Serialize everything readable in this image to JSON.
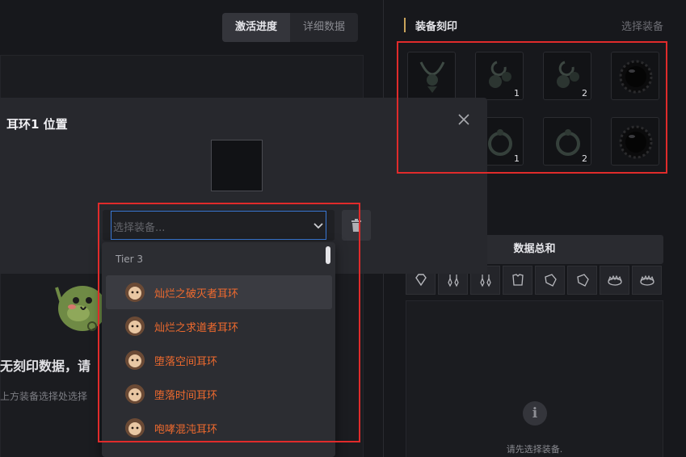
{
  "tabs": [
    {
      "label": "激活进度",
      "active": true
    },
    {
      "label": "详细数据",
      "active": false
    }
  ],
  "empty_state": {
    "title": "无刻印数据，请",
    "subtitle": "上方装备选择处选择"
  },
  "right_panel": {
    "section_title": "装备刻印",
    "select_link": "选择装备",
    "slots": [
      {
        "type": "necklace",
        "count": ""
      },
      {
        "type": "earring",
        "count": "1"
      },
      {
        "type": "earring",
        "count": "2"
      },
      {
        "type": "stone",
        "count": ""
      },
      {
        "type": "ring",
        "count": ""
      },
      {
        "type": "ring",
        "count": "1"
      },
      {
        "type": "ring",
        "count": "2"
      },
      {
        "type": "stone",
        "count": ""
      }
    ],
    "stats_title": "数据总和",
    "categories": [
      "diamond-icon",
      "earring-icon",
      "earring-icon",
      "chest-armor-icon",
      "glove-icon",
      "glove-icon",
      "crown-icon",
      "crown-icon"
    ],
    "hint": "请先选择装备."
  },
  "modal": {
    "title": "耳环1 位置",
    "select_placeholder": "选择装备..."
  },
  "dropdown": {
    "group_label": "Tier 3",
    "items": [
      {
        "label": "灿烂之破灭者耳环",
        "highlighted": true
      },
      {
        "label": "灿烂之求道者耳环",
        "highlighted": false
      },
      {
        "label": "堕落空间耳环",
        "highlighted": false
      },
      {
        "label": "堕落时间耳环",
        "highlighted": false
      },
      {
        "label": "咆哮混沌耳环",
        "highlighted": false
      }
    ]
  },
  "colors": {
    "accent_orange": "#ef6a2e",
    "focus_blue": "#3a78d6",
    "annotation_red": "#e02b2b",
    "section_gold": "#c9a45b"
  }
}
